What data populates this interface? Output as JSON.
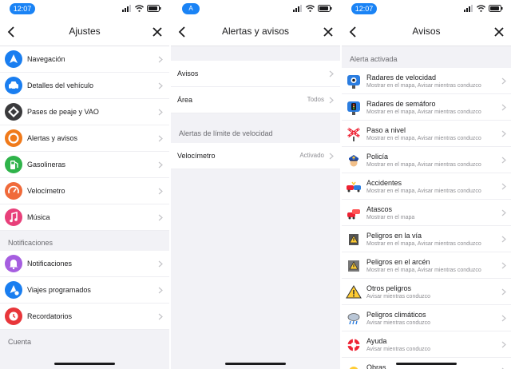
{
  "colors": {
    "accent": "#1a83f5"
  },
  "panel1": {
    "status": {
      "time": "12:07"
    },
    "title": "Ajustes",
    "items": [
      {
        "label": "Navegación",
        "icon": "navigation-arrow-icon",
        "color": "#1a7ef0"
      },
      {
        "label": "Detalles del vehículo",
        "icon": "car-icon",
        "color": "#1a7ef0"
      },
      {
        "label": "Pases de peaje y VAO",
        "icon": "toll-diamond-icon",
        "color": "#3a3a3c"
      },
      {
        "label": "Alertas y avisos",
        "icon": "alert-circle-icon",
        "color": "#f07a1a"
      },
      {
        "label": "Gasolineras",
        "icon": "gas-pump-icon",
        "color": "#2fb34a"
      },
      {
        "label": "Velocímetro",
        "icon": "speedometer-icon",
        "color": "#f06a3a"
      },
      {
        "label": "Música",
        "icon": "music-note-icon",
        "color": "#e8407a"
      }
    ],
    "section_notif": "Notificaciones",
    "notif_items": [
      {
        "label": "Notificaciones",
        "icon": "bell-icon",
        "color": "#a65ee0"
      },
      {
        "label": "Viajes programados",
        "icon": "scheduled-trip-icon",
        "color": "#1a7ef0"
      },
      {
        "label": "Recordatorios",
        "icon": "reminder-icon",
        "color": "#e8363a"
      }
    ],
    "section_account": "Cuenta"
  },
  "panel2": {
    "status": {
      "badge": "A"
    },
    "title": "Alertas y avisos",
    "rows": [
      {
        "label": "Avisos",
        "value": ""
      },
      {
        "label": "Área",
        "value": "Todos"
      }
    ],
    "section_speed": "Alertas de límite de velocidad",
    "speed_row": {
      "label": "Velocímetro",
      "value": "Activado"
    }
  },
  "panel3": {
    "status": {
      "time": "12:07"
    },
    "title": "Avisos",
    "section": "Alerta activada",
    "alerts": [
      {
        "title": "Radares de velocidad",
        "sub": "Mostrar en el mapa, Avisar mientras conduzco",
        "icon": "speed-camera-icon"
      },
      {
        "title": "Radares de semáforo",
        "sub": "Mostrar en el mapa, Avisar mientras conduzco",
        "icon": "traffic-light-camera-icon"
      },
      {
        "title": "Paso a nivel",
        "sub": "Mostrar en el mapa, Avisar mientras conduzco",
        "icon": "railroad-crossing-icon"
      },
      {
        "title": "Policía",
        "sub": "Mostrar en el mapa, Avisar mientras conduzco",
        "icon": "police-icon"
      },
      {
        "title": "Accidentes",
        "sub": "Mostrar en el mapa, Avisar mientras conduzco",
        "icon": "accident-icon"
      },
      {
        "title": "Atascos",
        "sub": "Mostrar en el mapa",
        "icon": "traffic-jam-icon"
      },
      {
        "title": "Peligros en la vía",
        "sub": "Mostrar en el mapa, Avisar mientras conduzco",
        "icon": "road-hazard-icon"
      },
      {
        "title": "Peligros en el arcén",
        "sub": "Mostrar en el mapa, Avisar mientras conduzco",
        "icon": "shoulder-hazard-icon"
      },
      {
        "title": "Otros peligros",
        "sub": "Avisar mientras conduzco",
        "icon": "warning-triangle-icon"
      },
      {
        "title": "Peligros climáticos",
        "sub": "Avisar mientras conduzco",
        "icon": "weather-hazard-icon"
      },
      {
        "title": "Ayuda",
        "sub": "Avisar mientras conduzco",
        "icon": "lifebuoy-icon"
      },
      {
        "title": "Obras",
        "sub": "",
        "icon": "construction-icon"
      }
    ]
  }
}
